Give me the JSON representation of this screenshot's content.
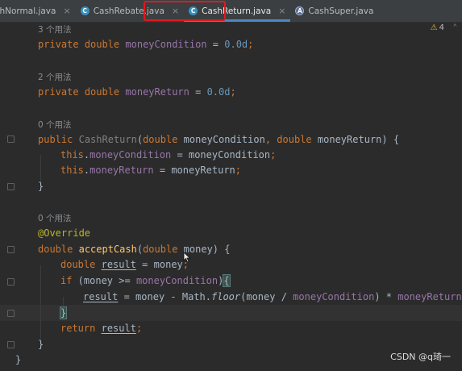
{
  "tabs": [
    {
      "label": "shNormal.java",
      "close": "×",
      "icon": "class-icon",
      "icon_text": "C"
    },
    {
      "label": "CashRebate.java",
      "close": "×",
      "icon": "class-icon",
      "icon_text": "C"
    },
    {
      "label": "CashReturn.java",
      "close": "×",
      "icon": "class-icon",
      "icon_text": "C",
      "active": true
    },
    {
      "label": "CashSuper.java",
      "close": "×",
      "icon": "abstract-class-icon",
      "icon_text": "A"
    }
  ],
  "inspection": {
    "count": "4",
    "warning_glyph": "⚠",
    "expand_glyph": "⌃"
  },
  "code": {
    "usages_3": "3 个用法",
    "usages_2": "2 个用法",
    "usages_0a": "0 个用法",
    "usages_0b": "0 个用法",
    "kw_private": "private",
    "kw_double": "double",
    "kw_public": "public",
    "kw_this": "this",
    "kw_if": "if",
    "kw_return": "return",
    "f_moneyCondition": "moneyCondition",
    "f_moneyReturn": "moneyReturn",
    "num_zero": "0.0d",
    "ctor_name": "CashReturn",
    "p_moneyCondition": "moneyCondition",
    "p_moneyReturn": "moneyReturn",
    "annotation": "@Override",
    "method_name": "acceptCash",
    "p_money": "money",
    "v_result": "result",
    "math_class": "Math",
    "math_method": "floor"
  },
  "watermark": "CSDN @q琦一"
}
